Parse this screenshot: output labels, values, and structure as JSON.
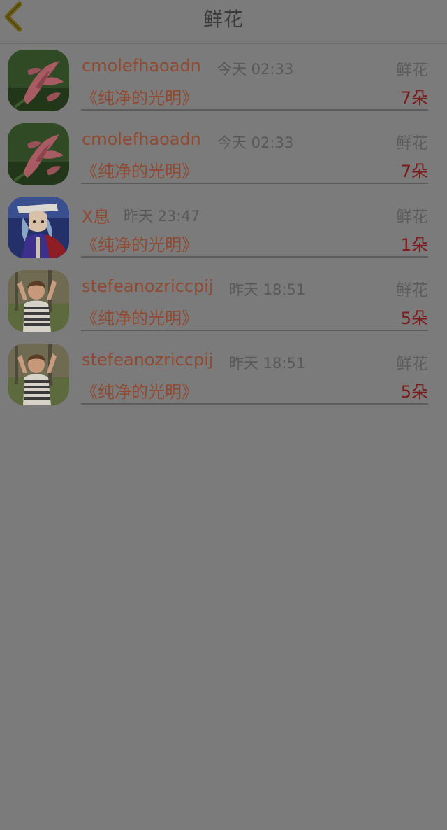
{
  "header": {
    "title": "鲜花"
  },
  "rows": [
    {
      "name": "cmolefhaoadn",
      "time": "今天 02:33",
      "type": "鲜花",
      "book": "《纯净的光明》",
      "count": "7朵",
      "avatar": "flower-avatar-icon"
    },
    {
      "name": "cmolefhaoadn",
      "time": "今天 02:33",
      "type": "鲜花",
      "book": "《纯净的光明》",
      "count": "7朵",
      "avatar": "flower-avatar-icon"
    },
    {
      "name": "X息",
      "time": "昨天 23:47",
      "type": "鲜花",
      "book": "《纯净的光明》",
      "count": "1朵",
      "avatar": "anime-avatar-icon"
    },
    {
      "name": "stefeanozriccpij",
      "time": "昨天 18:51",
      "type": "鲜花",
      "book": "《纯净的光明》",
      "count": "5朵",
      "avatar": "child-avatar-icon"
    },
    {
      "name": "stefeanozriccpij",
      "time": "昨天 18:51",
      "type": "鲜花",
      "book": "《纯净的光明》",
      "count": "5朵",
      "avatar": "child-avatar-icon"
    }
  ],
  "colors": {
    "background": "#7b7b7b",
    "name": "#8f4a31",
    "count": "#7b1b1b",
    "back_icon": "#6b5d12"
  }
}
